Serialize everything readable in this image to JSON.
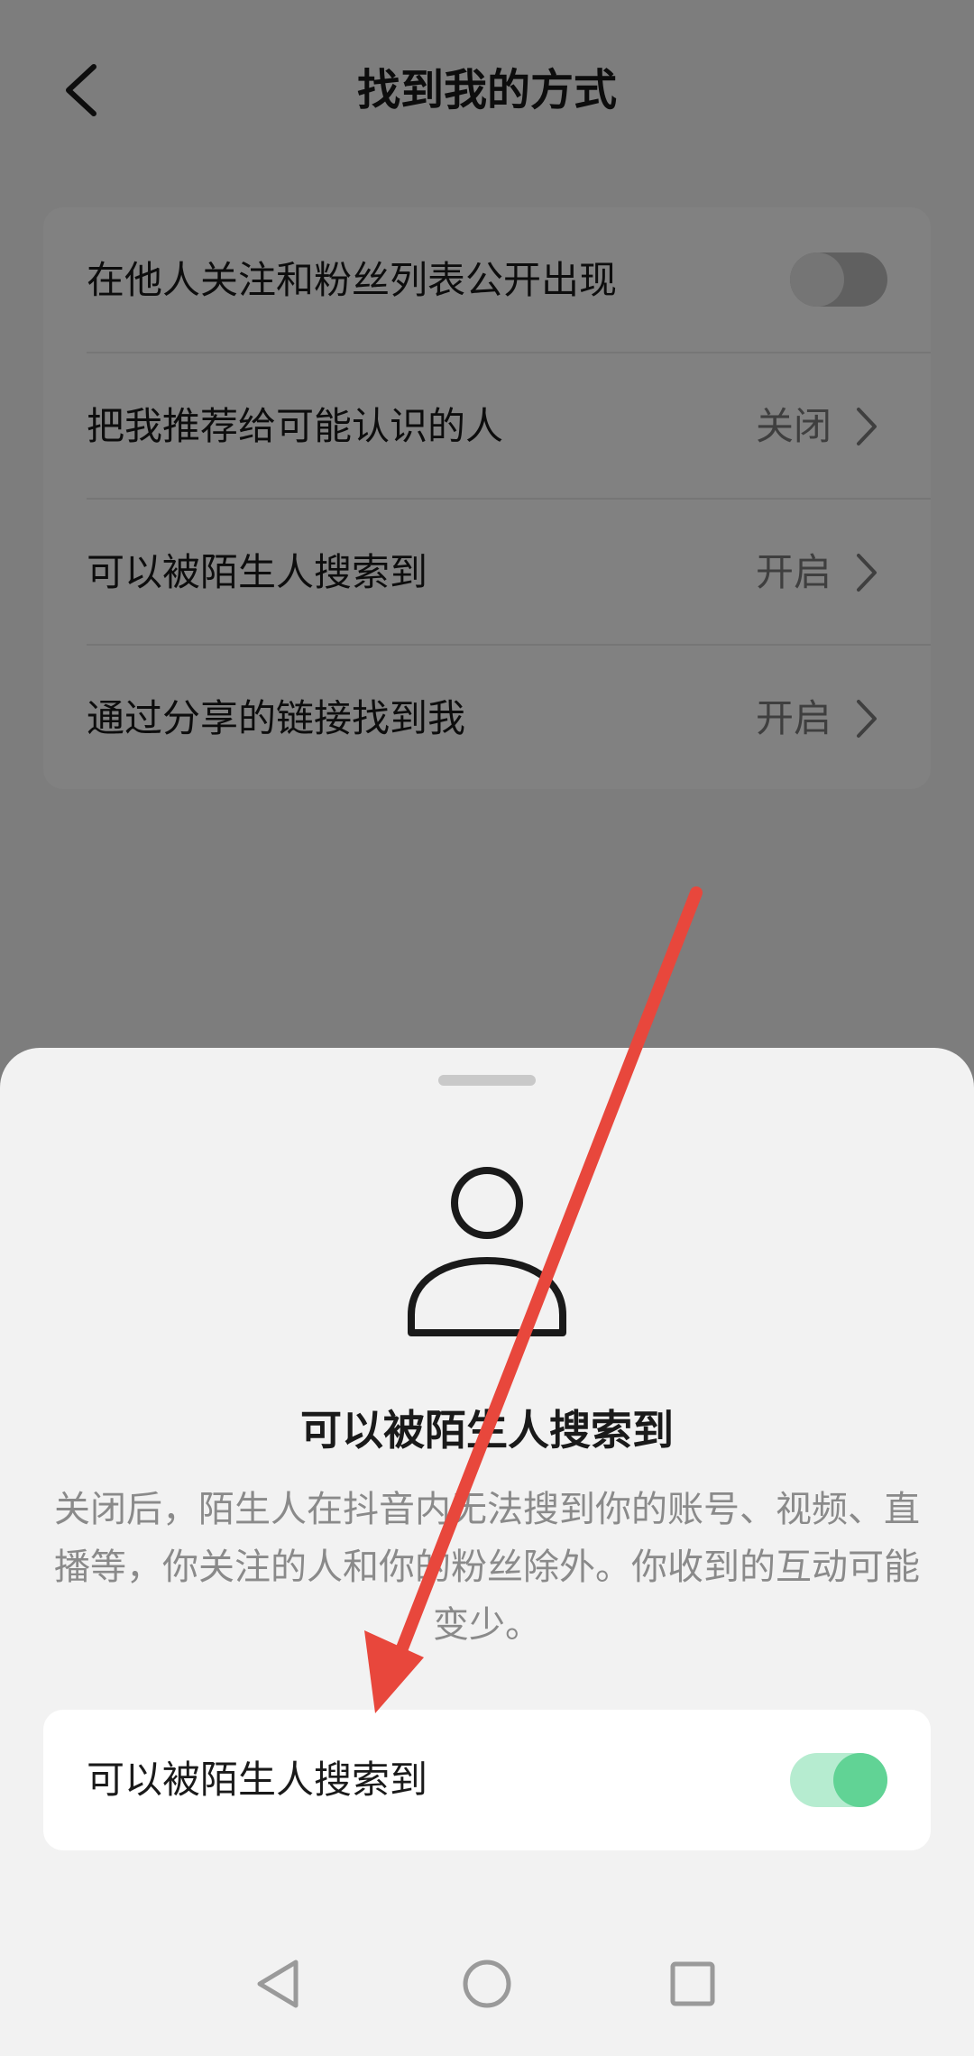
{
  "header": {
    "title": "找到我的方式",
    "back_icon": "chevron-left-icon"
  },
  "settings": {
    "rows": [
      {
        "label": "在他人关注和粉丝列表公开出现",
        "value": "",
        "toggle": "off"
      },
      {
        "label": "把我推荐给可能认识的人",
        "value": "关闭"
      },
      {
        "label": "可以被陌生人搜索到",
        "value": "开启"
      },
      {
        "label": "通过分享的链接找到我",
        "value": "开启"
      }
    ]
  },
  "sheet": {
    "icon": "person-icon",
    "title": "可以被陌生人搜索到",
    "description": "关闭后，陌生人在抖音内无法搜到你的账号、视频、直播等，你关注的人和你的粉丝除外。你收到的互动可能变少。",
    "option_label": "可以被陌生人搜索到",
    "option_state": "on"
  },
  "navbar": {
    "back": "back-triangle-icon",
    "home": "home-circle-icon",
    "recents": "recents-square-icon"
  },
  "colors": {
    "toggle_on": "#61d395",
    "toggle_on_track": "#b6ecd0",
    "arrow": "#e8473c"
  }
}
